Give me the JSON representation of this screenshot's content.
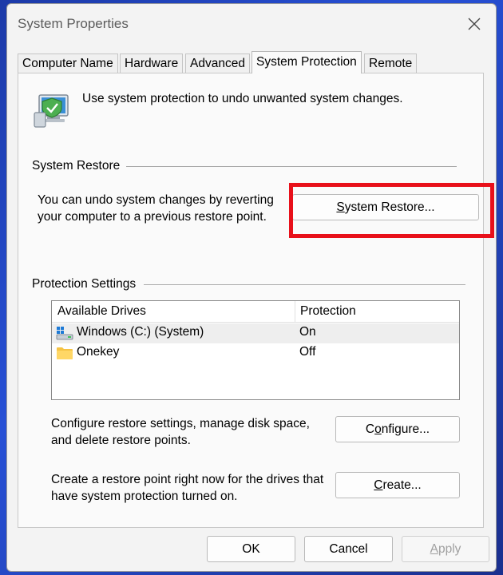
{
  "window": {
    "title": "System Properties"
  },
  "tabs": [
    {
      "label": "Computer Name",
      "active": false
    },
    {
      "label": "Hardware",
      "active": false
    },
    {
      "label": "Advanced",
      "active": false
    },
    {
      "label": "System Protection",
      "active": true
    },
    {
      "label": "Remote",
      "active": false
    }
  ],
  "intro": {
    "text": "Use system protection to undo unwanted system changes."
  },
  "system_restore": {
    "group_title": "System Restore",
    "description_line1": "You can undo system changes by reverting",
    "description_line2": "your computer to a previous restore point.",
    "button_label_mnemonic": "S",
    "button_label_rest": "ystem Restore..."
  },
  "protection_settings": {
    "group_title": "Protection Settings",
    "columns": [
      "Available Drives",
      "Protection"
    ],
    "drives": [
      {
        "name": "Windows (C:) (System)",
        "protection": "On",
        "icon": "system-drive-icon",
        "selected": true
      },
      {
        "name": "Onekey",
        "protection": "Off",
        "icon": "folder-icon",
        "selected": false
      }
    ],
    "configure_line1": "Configure restore settings, manage disk space,",
    "configure_line2": "and delete restore points.",
    "configure_btn_pre": "C",
    "configure_btn_mn": "o",
    "configure_btn_post": "nfigure...",
    "create_line1": "Create a restore point right now for the drives that",
    "create_line2": "have system protection turned on.",
    "create_btn_mn": "C",
    "create_btn_post": "reate..."
  },
  "footer": {
    "ok_label": "OK",
    "cancel_label": "Cancel",
    "apply_mn": "A",
    "apply_post": "pply"
  },
  "colors": {
    "highlight": "#e8101a",
    "accent": "#0a63c9"
  }
}
